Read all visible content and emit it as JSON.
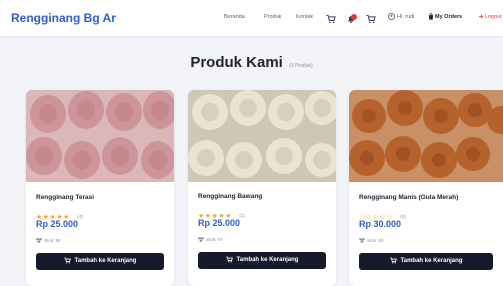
{
  "brand": "Rengginang Bg Ar",
  "nav": {
    "beranda": "Beranda",
    "produk": "Produk",
    "kontak": "Kontak",
    "user": "Hi, rudi",
    "orders": "My Orders",
    "logout": "Logout"
  },
  "section": {
    "title": "Produk Kami",
    "count": "(3 Produk)"
  },
  "products": [
    {
      "name": "Rengginang Terasi",
      "stars": "★★★★★",
      "rating_count": "(4)",
      "price": "Rp 25.000",
      "stock": "Stok: 95",
      "button": "Tambah ke Keranjang"
    },
    {
      "name": "Rengginang Bawang",
      "stars": "★★★★★",
      "rating_count": "(1)",
      "price": "Rp 25.000",
      "stock": "Stok: 97",
      "button": "Tambah ke Keranjang"
    },
    {
      "name": "Rengginang Manis (Gula Merah)",
      "stars": "☆☆☆☆☆",
      "rating_count": "(0)",
      "price": "Rp 30.000",
      "stock": "Stok: 80",
      "button": "Tambah ke Keranjang"
    }
  ],
  "colors": {
    "accent": "#2f5bd3",
    "button": "#161a2c",
    "star": "#f4a81d",
    "logout": "#e0393e"
  }
}
